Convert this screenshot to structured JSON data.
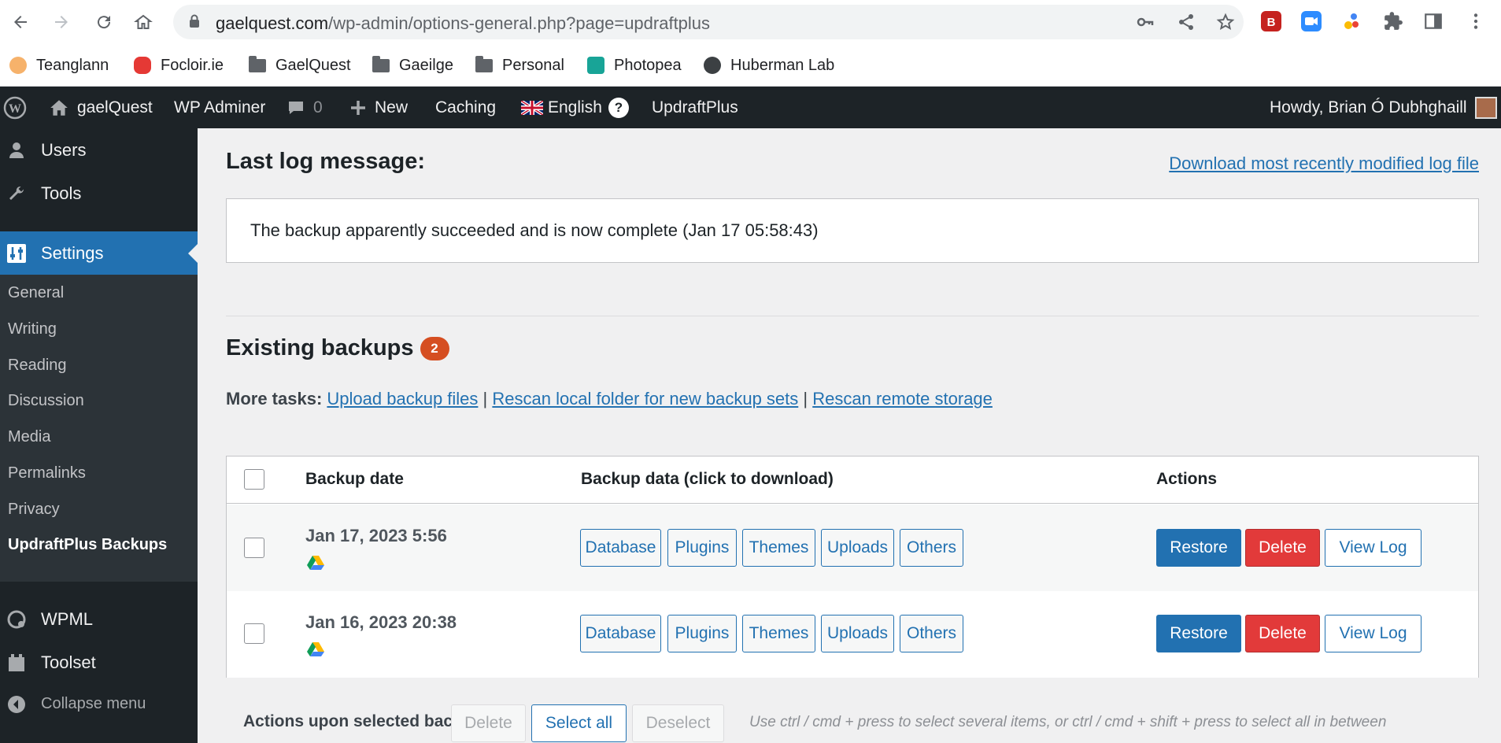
{
  "browser": {
    "url_host": "gaelquest.com",
    "url_path": "/wp-admin/options-general.php?page=updraftplus",
    "bookmarks": [
      {
        "label": "Teanglann"
      },
      {
        "label": "Focloir.ie"
      },
      {
        "label": "GaelQuest"
      },
      {
        "label": "Gaeilge"
      },
      {
        "label": "Personal"
      },
      {
        "label": "Photopea"
      },
      {
        "label": "Huberman Lab"
      }
    ]
  },
  "adminbar": {
    "site_name": "gaelQuest",
    "wp_adminer": "WP Adminer",
    "comments_count": "0",
    "new_label": "New",
    "caching": "Caching",
    "language": "English",
    "help": "?",
    "updraft": "UpdraftPlus",
    "howdy": "Howdy, Brian Ó Dubhghaill"
  },
  "sidebar": {
    "users": "Users",
    "tools": "Tools",
    "settings": "Settings",
    "submenu": [
      "General",
      "Writing",
      "Reading",
      "Discussion",
      "Media",
      "Permalinks",
      "Privacy",
      "UpdraftPlus Backups"
    ],
    "wpml": "WPML",
    "toolset": "Toolset",
    "collapse": "Collapse menu"
  },
  "main": {
    "log_heading": "Last log message:",
    "download_log": "Download most recently modified log file",
    "log_message": "The backup apparently succeeded and is now complete (Jan 17 05:58:43)",
    "existing_heading": "Existing backups",
    "existing_count": "2",
    "more_tasks_label": "More tasks:",
    "task_upload": "Upload backup files",
    "task_rescan_local": "Rescan local folder for new backup sets",
    "task_rescan_remote": "Rescan remote storage",
    "separator": "|",
    "table": {
      "col_date": "Backup date",
      "col_data": "Backup data (click to download)",
      "col_actions": "Actions",
      "rows": [
        {
          "date": "Jan 17, 2023 5:56"
        },
        {
          "date": "Jan 16, 2023 20:38"
        }
      ],
      "data_buttons": [
        "Database",
        "Plugins",
        "Themes",
        "Uploads",
        "Others"
      ],
      "restore": "Restore",
      "delete": "Delete",
      "view_log": "View Log"
    },
    "bottom": {
      "label": "Actions upon selected backups",
      "delete": "Delete",
      "select_all": "Select all",
      "deselect": "Deselect",
      "hint": "Use ctrl / cmd + press to select several items, or ctrl / cmd + shift + press to select all in between"
    }
  },
  "colors": {
    "admin_dark": "#1d2327",
    "wp_blue": "#2271b1",
    "delete_red": "#e23a3a",
    "badge_orange": "#d54e21"
  }
}
